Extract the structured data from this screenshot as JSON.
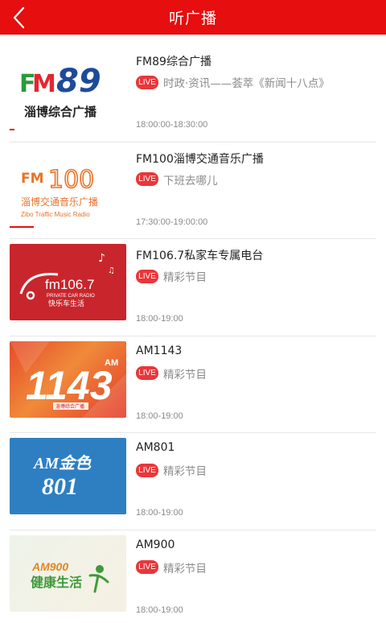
{
  "header": {
    "title": "听广播"
  },
  "live_badge": "LIVE",
  "stations": [
    {
      "name": "FM89综合广播",
      "program": "时政·资讯——荟萃《新闻十八点》",
      "time": "18:00:00-18:30:00",
      "progress": 0.04,
      "logo_text": "淄博综合广播",
      "logo_mark": "FM89"
    },
    {
      "name": "FM100淄博交通音乐广播",
      "program": "下班去哪儿",
      "time": "17:30:00-19:00:00",
      "progress": 0.21,
      "logo_text": "淄博交通音乐广播",
      "logo_sub": "Zibo Traffic Music Radio",
      "logo_mark": "FM100"
    },
    {
      "name": "FM106.7私家车专属电台",
      "program": "精彩节目",
      "time": "18:00-19:00",
      "progress": 0.0,
      "logo_mark": "fm106.7",
      "logo_text": "快乐车生活",
      "logo_sub": "PRIVATE CAR RADIO"
    },
    {
      "name": "AM1143",
      "program": "精彩节目",
      "time": "18:00-19:00",
      "progress": 0.0,
      "logo_mark": "1143",
      "logo_text": "淄博综合广播"
    },
    {
      "name": "AM801",
      "program": "精彩节目",
      "time": "18:00-19:00",
      "progress": 0.0,
      "logo_mark": "AM金色",
      "logo_text": "801"
    },
    {
      "name": "AM900",
      "program": "精彩节目",
      "time": "18:00-19:00",
      "progress": 0.0,
      "logo_mark": "AM900",
      "logo_text": "健康生活"
    }
  ],
  "colors": {
    "header": "#e60e0e",
    "live": "#e8373a",
    "accent": "#e60e0e"
  }
}
